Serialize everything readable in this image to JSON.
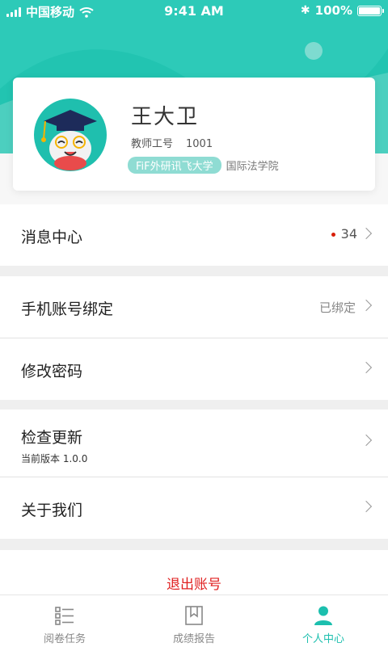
{
  "status_bar": {
    "carrier": "中国移动",
    "time": "9:41 AM",
    "battery": "100%"
  },
  "profile": {
    "name": "王大卫",
    "id_label": "教师工号",
    "id_value": "1001",
    "school": "FiF外研讯飞大学",
    "department": "国际法学院"
  },
  "menu": {
    "messages": {
      "label": "消息中心",
      "count": "34"
    },
    "bind_phone": {
      "label": "手机账号绑定",
      "status": "已绑定"
    },
    "change_password": {
      "label": "修改密码"
    },
    "check_update": {
      "label": "检查更新",
      "version": "当前版本 1.0.0"
    },
    "about": {
      "label": "关于我们"
    }
  },
  "logout_label": "退出账号",
  "tabs": [
    {
      "label": "阅卷任务",
      "icon": "list-icon",
      "active": false
    },
    {
      "label": "成绩报告",
      "icon": "bookmark-report-icon",
      "active": false
    },
    {
      "label": "个人中心",
      "icon": "person-icon",
      "active": true
    }
  ],
  "colors": {
    "accent": "#1cbfae",
    "header": "#22c4b1",
    "logout": "#e02020",
    "badge_dot": "#d81e06"
  }
}
